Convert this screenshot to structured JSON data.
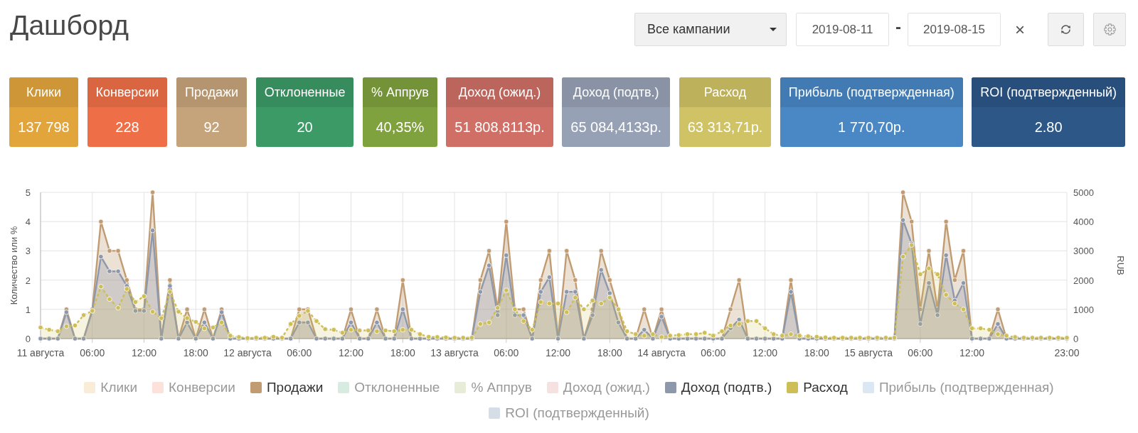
{
  "header": {
    "title": "Дашборд",
    "campaign_select": {
      "value": "Все кампании"
    },
    "date_from": {
      "value": "2019-08-11"
    },
    "separator": "-",
    "date_to": {
      "value": "2019-08-15"
    },
    "clear_button": "×"
  },
  "cards": [
    {
      "label": "Клики",
      "value": "137 798",
      "color": "#e2a53c"
    },
    {
      "label": "Конверсии",
      "value": "228",
      "color": "#ee6f47"
    },
    {
      "label": "Продажи",
      "value": "92",
      "color": "#c6a47b"
    },
    {
      "label": "Отклоненные",
      "value": "20",
      "color": "#3c9a67"
    },
    {
      "label": "% Аппрув",
      "value": "40,35%",
      "color": "#80a23e"
    },
    {
      "label": "Доход (ожид.)",
      "value": "51 808,8113р.",
      "color": "#cf6f66"
    },
    {
      "label": "Доход (подтв.)",
      "value": "65 084,4133р.",
      "color": "#97a1b5"
    },
    {
      "label": "Расход",
      "value": "63 313,71р.",
      "color": "#d0c365"
    },
    {
      "label": "Прибыль (подтвержденная)",
      "value": "1 770,70р.",
      "color": "#4987c5"
    },
    {
      "label": "ROI (подтвержденный)",
      "value": "2.80",
      "color": "#2c5787"
    }
  ],
  "chart": {
    "chart_data": {
      "type": "area",
      "grid": true,
      "ylabel": "Количество или %",
      "y2label": "RUB",
      "x": [
        "2019-08-11T00:00",
        "2019-08-11T01:00",
        "2019-08-11T02:00",
        "2019-08-11T03:00",
        "2019-08-11T04:00",
        "2019-08-11T05:00",
        "2019-08-11T06:00",
        "2019-08-11T07:00",
        "2019-08-11T08:00",
        "2019-08-11T09:00",
        "2019-08-11T10:00",
        "2019-08-11T11:00",
        "2019-08-11T12:00",
        "2019-08-11T13:00",
        "2019-08-11T14:00",
        "2019-08-11T15:00",
        "2019-08-11T16:00",
        "2019-08-11T17:00",
        "2019-08-11T18:00",
        "2019-08-11T19:00",
        "2019-08-11T20:00",
        "2019-08-11T21:00",
        "2019-08-11T22:00",
        "2019-08-11T23:00",
        "2019-08-12T00:00",
        "2019-08-12T01:00",
        "2019-08-12T02:00",
        "2019-08-12T03:00",
        "2019-08-12T04:00",
        "2019-08-12T05:00",
        "2019-08-12T06:00",
        "2019-08-12T07:00",
        "2019-08-12T08:00",
        "2019-08-12T09:00",
        "2019-08-12T10:00",
        "2019-08-12T11:00",
        "2019-08-12T12:00",
        "2019-08-12T13:00",
        "2019-08-12T14:00",
        "2019-08-12T15:00",
        "2019-08-12T16:00",
        "2019-08-12T17:00",
        "2019-08-12T18:00",
        "2019-08-12T19:00",
        "2019-08-12T20:00",
        "2019-08-12T21:00",
        "2019-08-12T22:00",
        "2019-08-12T23:00",
        "2019-08-13T00:00",
        "2019-08-13T01:00",
        "2019-08-13T02:00",
        "2019-08-13T03:00",
        "2019-08-13T04:00",
        "2019-08-13T05:00",
        "2019-08-13T06:00",
        "2019-08-13T07:00",
        "2019-08-13T08:00",
        "2019-08-13T09:00",
        "2019-08-13T10:00",
        "2019-08-13T11:00",
        "2019-08-13T12:00",
        "2019-08-13T13:00",
        "2019-08-13T14:00",
        "2019-08-13T15:00",
        "2019-08-13T16:00",
        "2019-08-13T17:00",
        "2019-08-13T18:00",
        "2019-08-13T19:00",
        "2019-08-13T20:00",
        "2019-08-13T21:00",
        "2019-08-13T22:00",
        "2019-08-13T23:00",
        "2019-08-14T00:00",
        "2019-08-14T01:00",
        "2019-08-14T02:00",
        "2019-08-14T03:00",
        "2019-08-14T04:00",
        "2019-08-14T05:00",
        "2019-08-14T06:00",
        "2019-08-14T07:00",
        "2019-08-14T08:00",
        "2019-08-14T09:00",
        "2019-08-14T10:00",
        "2019-08-14T11:00",
        "2019-08-14T12:00",
        "2019-08-14T13:00",
        "2019-08-14T14:00",
        "2019-08-14T15:00",
        "2019-08-14T16:00",
        "2019-08-14T17:00",
        "2019-08-14T18:00",
        "2019-08-14T19:00",
        "2019-08-14T20:00",
        "2019-08-14T21:00",
        "2019-08-14T22:00",
        "2019-08-14T23:00",
        "2019-08-15T00:00",
        "2019-08-15T01:00",
        "2019-08-15T02:00",
        "2019-08-15T03:00",
        "2019-08-15T04:00",
        "2019-08-15T05:00",
        "2019-08-15T06:00",
        "2019-08-15T07:00",
        "2019-08-15T08:00",
        "2019-08-15T09:00",
        "2019-08-15T10:00",
        "2019-08-15T11:00",
        "2019-08-15T12:00",
        "2019-08-15T13:00",
        "2019-08-15T14:00",
        "2019-08-15T15:00",
        "2019-08-15T16:00",
        "2019-08-15T17:00",
        "2019-08-15T18:00",
        "2019-08-15T19:00",
        "2019-08-15T20:00",
        "2019-08-15T21:00",
        "2019-08-15T22:00",
        "2019-08-15T23:00"
      ],
      "xlim": [
        "2019-08-11T00:00",
        "2019-08-15T23:00"
      ],
      "ylim": [
        0,
        5
      ],
      "yticks": [
        0,
        1,
        2,
        3,
        4,
        5
      ],
      "y2lim": [
        0,
        5000
      ],
      "y2ticks": [
        0,
        1000,
        2000,
        3000,
        4000,
        5000
      ],
      "xticks": [
        {
          "value": "2019-08-11T00:00",
          "label": "11 августа"
        },
        {
          "value": "2019-08-11T06:00",
          "label": "06:00"
        },
        {
          "value": "2019-08-11T12:00",
          "label": "12:00"
        },
        {
          "value": "2019-08-11T18:00",
          "label": "18:00"
        },
        {
          "value": "2019-08-12T00:00",
          "label": "12 августа"
        },
        {
          "value": "2019-08-12T06:00",
          "label": "06:00"
        },
        {
          "value": "2019-08-12T12:00",
          "label": "12:00"
        },
        {
          "value": "2019-08-12T18:00",
          "label": "18:00"
        },
        {
          "value": "2019-08-13T00:00",
          "label": "13 августа"
        },
        {
          "value": "2019-08-13T06:00",
          "label": "06:00"
        },
        {
          "value": "2019-08-13T12:00",
          "label": "12:00"
        },
        {
          "value": "2019-08-13T18:00",
          "label": "18:00"
        },
        {
          "value": "2019-08-14T00:00",
          "label": "14 августа"
        },
        {
          "value": "2019-08-14T06:00",
          "label": "06:00"
        },
        {
          "value": "2019-08-14T12:00",
          "label": "12:00"
        },
        {
          "value": "2019-08-14T18:00",
          "label": "18:00"
        },
        {
          "value": "2019-08-15T00:00",
          "label": "15 августа"
        },
        {
          "value": "2019-08-15T06:00",
          "label": "06:00"
        },
        {
          "value": "2019-08-15T12:00",
          "label": "12:00"
        },
        {
          "value": "2019-08-15T23:00",
          "label": "23:00"
        }
      ],
      "series": [
        {
          "color": "#c19c73",
          "axis": "y",
          "line_style": "solid",
          "values": [
            0,
            0,
            0,
            1,
            0,
            0,
            1,
            4,
            3,
            3,
            2,
            1,
            1,
            5,
            0,
            2,
            0,
            1,
            0,
            1,
            0,
            1,
            0,
            0,
            0,
            0,
            0,
            0,
            0,
            0,
            1,
            1,
            0,
            0,
            0,
            0,
            1,
            0,
            0,
            1,
            0,
            0,
            2,
            0,
            0,
            0,
            0,
            0,
            0,
            0,
            0,
            2,
            3,
            1,
            4,
            1,
            1,
            0,
            2,
            3,
            0,
            3,
            2,
            0,
            1,
            3,
            2,
            1,
            0,
            0,
            1,
            0,
            1,
            0,
            0,
            0,
            0,
            0,
            0,
            0,
            1,
            2,
            0,
            0,
            0,
            0,
            0,
            2,
            0,
            0,
            0,
            0,
            0,
            0,
            0,
            0,
            0,
            0,
            0,
            0,
            5,
            4,
            1,
            3,
            1,
            4,
            2,
            3,
            0,
            0,
            0,
            1,
            0,
            0,
            0,
            0,
            0,
            0,
            0,
            0
          ]
        },
        {
          "color": "#8e98ab",
          "axis": "y2",
          "line_style": "solid",
          "values": [
            0,
            0,
            0,
            900,
            0,
            0,
            950,
            2800,
            2300,
            2300,
            1800,
            950,
            950,
            3700,
            0,
            1800,
            0,
            550,
            0,
            550,
            0,
            900,
            0,
            0,
            0,
            0,
            0,
            0,
            0,
            0,
            550,
            550,
            0,
            0,
            0,
            0,
            550,
            0,
            0,
            550,
            0,
            0,
            1000,
            0,
            0,
            0,
            0,
            0,
            0,
            0,
            0,
            1600,
            2500,
            800,
            2850,
            800,
            800,
            0,
            1600,
            2100,
            0,
            1600,
            1600,
            0,
            800,
            2350,
            1550,
            550,
            0,
            0,
            300,
            0,
            750,
            0,
            0,
            0,
            0,
            0,
            0,
            0,
            350,
            650,
            0,
            0,
            0,
            0,
            0,
            1600,
            0,
            0,
            0,
            0,
            0,
            0,
            0,
            0,
            0,
            0,
            0,
            0,
            4050,
            3250,
            500,
            1900,
            800,
            2850,
            1300,
            1900,
            0,
            0,
            0,
            500,
            0,
            0,
            0,
            0,
            0,
            0,
            0,
            0
          ]
        },
        {
          "color": "#cdbe58",
          "axis": "y2",
          "line_style": "dashed",
          "values": [
            380,
            300,
            250,
            420,
            450,
            800,
            950,
            1780,
            1350,
            1050,
            1700,
            1250,
            1450,
            920,
            700,
            1600,
            920,
            700,
            570,
            350,
            380,
            550,
            100,
            50,
            20,
            30,
            30,
            60,
            30,
            500,
            780,
            950,
            600,
            320,
            300,
            200,
            300,
            280,
            280,
            250,
            280,
            250,
            300,
            300,
            150,
            60,
            50,
            40,
            30,
            30,
            30,
            500,
            550,
            1050,
            1650,
            1000,
            600,
            300,
            1250,
            1200,
            1200,
            900,
            1400,
            1000,
            1300,
            1200,
            1400,
            1000,
            250,
            150,
            100,
            150,
            50,
            100,
            120,
            150,
            150,
            200,
            100,
            250,
            450,
            500,
            600,
            600,
            350,
            150,
            100,
            150,
            100,
            80,
            60,
            40,
            30,
            30,
            30,
            30,
            30,
            30,
            30,
            30,
            2800,
            3200,
            2200,
            2400,
            2200,
            1500,
            1200,
            1000,
            350,
            350,
            300,
            150,
            100,
            50,
            30,
            30,
            30,
            30,
            30,
            30
          ]
        }
      ]
    },
    "legend": [
      {
        "label": "Клики",
        "color": "#f9edd8",
        "on": false
      },
      {
        "label": "Конверсии",
        "color": "#fce2da",
        "on": false
      },
      {
        "label": "Продажи",
        "color": "#c19c73",
        "on": true
      },
      {
        "label": "Отклоненные",
        "color": "#d8ebe1",
        "on": false
      },
      {
        "label": "% Аппрув",
        "color": "#e6ecd8",
        "on": false
      },
      {
        "label": "Доход (ожид.)",
        "color": "#f5e2e0",
        "on": false
      },
      {
        "label": "Доход (подтв.)",
        "color": "#8e98ab",
        "on": true
      },
      {
        "label": "Расход",
        "color": "#cdbe58",
        "on": true
      },
      {
        "label": "Прибыль (подтвержденная)",
        "color": "#dbe7f3",
        "on": false
      },
      {
        "label": "ROI (подтвержденный)",
        "color": "#d5dde7",
        "on": false
      }
    ]
  }
}
